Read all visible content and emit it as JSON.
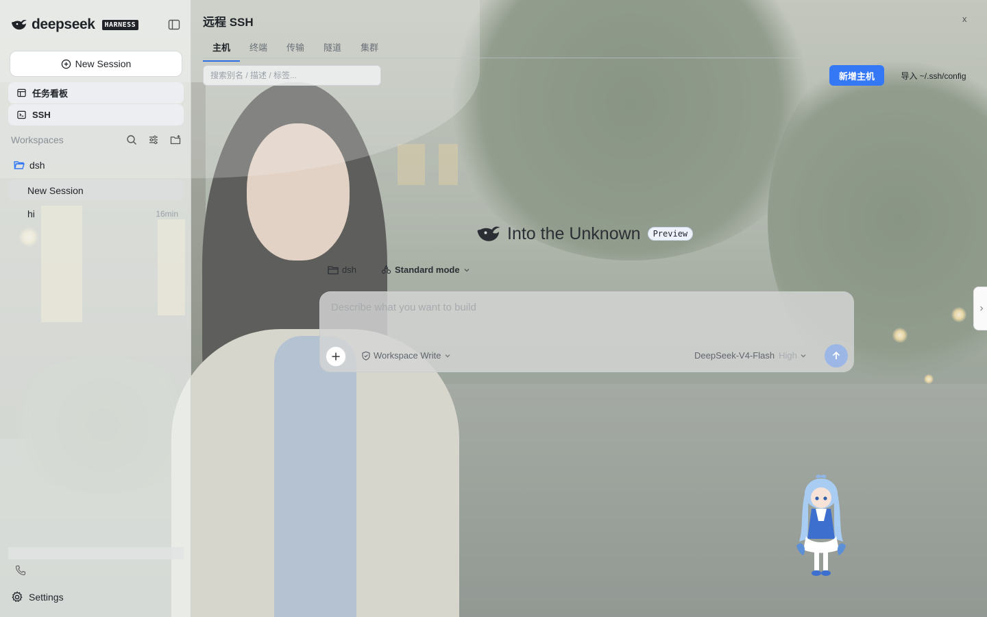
{
  "brand": {
    "name": "deepseek",
    "badge": "HARNESS"
  },
  "sidebar": {
    "new_session_label": "New Session",
    "nav": [
      {
        "label": "任务看板",
        "icon": "board-icon"
      },
      {
        "label": "SSH",
        "icon": "terminal-icon"
      }
    ],
    "workspaces_title": "Workspaces",
    "workspace": {
      "name": "dsh",
      "sessions": [
        {
          "title": "New Session",
          "meta": "",
          "active": true
        },
        {
          "title": "hi",
          "meta": "16min",
          "active": false
        }
      ]
    },
    "settings_label": "Settings"
  },
  "ssh": {
    "title": "远程 SSH",
    "close_label": "x",
    "tabs": [
      {
        "label": "主机",
        "active": true
      },
      {
        "label": "终端",
        "active": false
      },
      {
        "label": "传输",
        "active": false
      },
      {
        "label": "隧道",
        "active": false
      },
      {
        "label": "集群",
        "active": false
      }
    ],
    "search_placeholder": "搜索别名 / 描述 / 标签...",
    "add_host_label": "新增主机",
    "import_label": "导入 ~/.ssh/config"
  },
  "hero": {
    "title": "Into the Unknown",
    "badge": "Preview"
  },
  "context": {
    "folder": "dsh",
    "mode": "Standard mode"
  },
  "composer": {
    "placeholder": "Describe what you want to build",
    "permission": "Workspace Write",
    "model": "DeepSeek-V4-Flash",
    "effort": "High"
  },
  "colors": {
    "accent": "#3478f6",
    "send_disabled": "#9cb6e6",
    "folder": "#3478f6"
  }
}
